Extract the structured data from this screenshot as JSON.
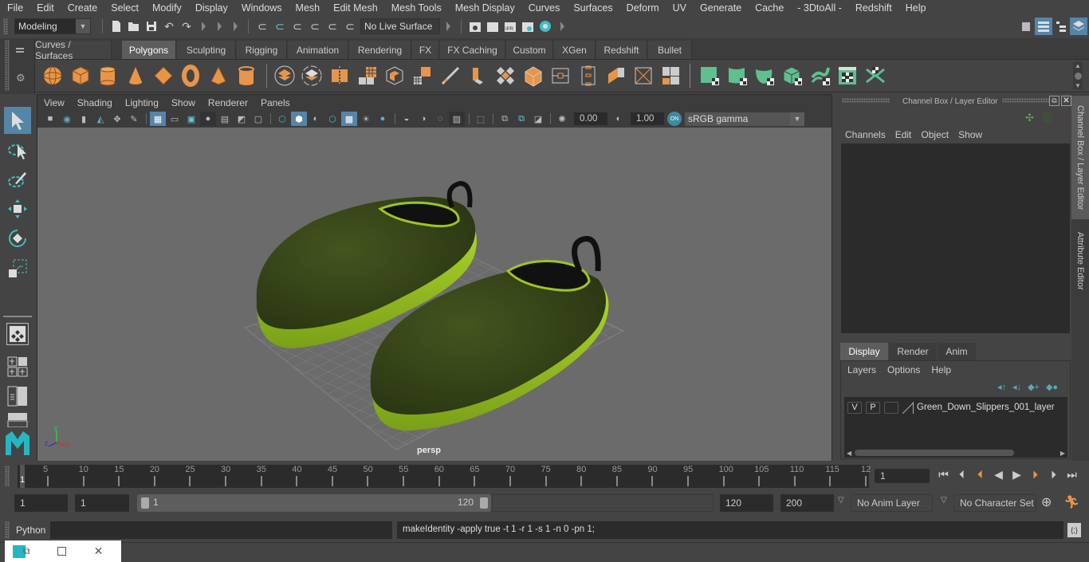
{
  "menubar": [
    "File",
    "Edit",
    "Create",
    "Select",
    "Modify",
    "Display",
    "Windows",
    "Mesh",
    "Edit Mesh",
    "Mesh Tools",
    "Mesh Display",
    "Curves",
    "Surfaces",
    "Deform",
    "UV",
    "Generate",
    "Cache",
    "- 3DtoAll -",
    "Redshift",
    "Help"
  ],
  "statusline": {
    "mode_selector": "Modeling",
    "live_surface": "No Live Surface"
  },
  "shelf_tabs": [
    "Curves / Surfaces",
    "Polygons",
    "Sculpting",
    "Rigging",
    "Animation",
    "Rendering",
    "FX",
    "FX Caching",
    "Custom",
    "XGen",
    "Redshift",
    "Bullet"
  ],
  "active_shelf_tab": "Polygons",
  "shelf_icons": {
    "orange": [
      "poly-sphere-icon",
      "poly-cube-icon",
      "poly-cylinder-icon",
      "poly-cone-icon",
      "poly-diamond-icon",
      "poly-torus-icon",
      "poly-pyramid-icon",
      "poly-pipe-icon"
    ],
    "gray": [
      "combine-icon",
      "separate-icon",
      "mirror-icon",
      "smooth-icon",
      "bevel-icon",
      "bridge-icon",
      "multi-cut-icon",
      "extrude-icon",
      "merge-icon",
      "fill-hole-icon",
      "target-weld-icon",
      "edge-loop-icon",
      "crease-icon",
      "quad-draw-icon",
      "bool-icon"
    ],
    "green": [
      "planar-uv-icon",
      "cylindrical-uv-icon",
      "spherical-uv-icon",
      "automatic-uv-icon",
      "unfold-uv-icon",
      "uv-editor-icon",
      "sew-uv-icon"
    ]
  },
  "viewport": {
    "menu": [
      "View",
      "Shading",
      "Lighting",
      "Show",
      "Renderer",
      "Panels"
    ],
    "exposure": "0.00",
    "gamma": "1.00",
    "color_management_toggle": "ON",
    "color_space": "sRGB gamma",
    "camera_label": "persp",
    "axis_labels": {
      "x": "x",
      "y": "y",
      "z": "z"
    }
  },
  "channel_box": {
    "title": "Channel Box / Layer Editor",
    "menu": [
      "Channels",
      "Edit",
      "Object",
      "Show"
    ]
  },
  "layer_editor": {
    "tabs": [
      "Display",
      "Render",
      "Anim"
    ],
    "active_tab": "Display",
    "menu": [
      "Layers",
      "Options",
      "Help"
    ],
    "layers": [
      {
        "visible": "V",
        "playback": "P",
        "name": "Green_Down_Slippers_001_layer"
      }
    ]
  },
  "side_tabs": [
    "Channel Box / Layer Editor",
    "Attribute Editor"
  ],
  "timeline": {
    "ticks": [
      5,
      10,
      15,
      20,
      25,
      30,
      35,
      40,
      45,
      50,
      55,
      60,
      65,
      70,
      75,
      80,
      85,
      90,
      95,
      100,
      105,
      110,
      115,
      "12"
    ],
    "current_frame_marker": "1",
    "current_frame": "1"
  },
  "range": {
    "start_frame": "1",
    "playback_start": "1",
    "slider_start": "1",
    "slider_end": "120",
    "playback_end": "120",
    "end_frame": "200",
    "anim_layer": "No Anim Layer",
    "character_set": "No Character Set"
  },
  "command_line": {
    "language": "Python",
    "input": "",
    "result": "makeIdentity -apply true -t 1 -r 1 -s 1 -n 0 -pn 1;"
  },
  "colors": {
    "accent_blue": "#5585a8",
    "shelf_orange": "#e8954a",
    "shelf_green": "#5fbf8f",
    "teal": "#3cbfc8",
    "viewport_bg": "#6b6b6b",
    "slipper_body": "#3a4a1c",
    "slipper_sole": "#9cc524"
  }
}
